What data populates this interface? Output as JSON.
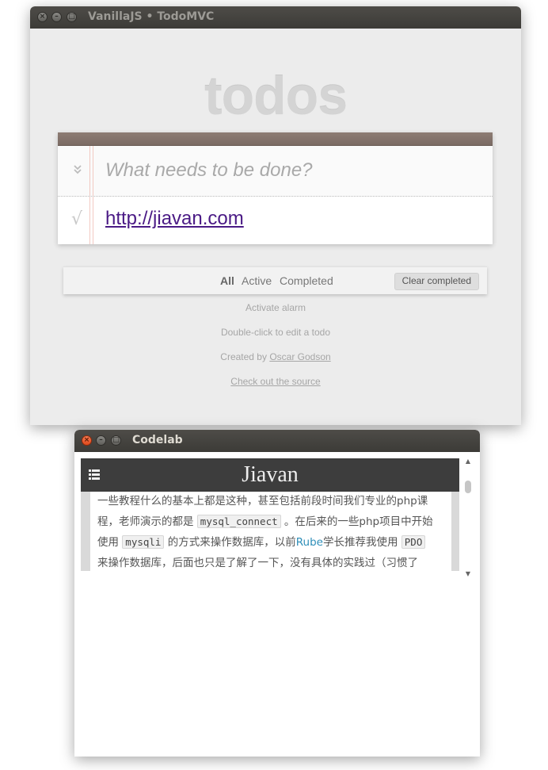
{
  "window1": {
    "title": "VanillaJS • TodoMVC",
    "app_title": "todos",
    "new_todo_placeholder": "What needs to be done?",
    "toggle_all_icon": "double-chevron-down-icon",
    "todos": [
      {
        "text": "http://jiavan.com",
        "completed": true
      }
    ],
    "check_glyph": "√",
    "filters": {
      "all": "All",
      "active": "Active",
      "completed": "Completed",
      "selected": "All"
    },
    "clear_completed": "Clear completed",
    "info": {
      "activate_alarm": "Activate alarm",
      "edit_hint": "Double-click to edit a todo",
      "created_by_prefix": "Created by ",
      "created_by_name": "Oscar Godson",
      "source_link": "Check out the source"
    }
  },
  "window2": {
    "title": "Codelab",
    "site_title": "Jiavan",
    "article": {
      "line1": "一些教程什么的基本上都是这种，甚至包括前段时间我们专业的php课",
      "line2_a": "程，老师演示的都是 ",
      "line2_code": "mysql_connect",
      "line2_b": " 。在后来的一些php项目中开始",
      "line3_a": "使用 ",
      "line3_code": "mysqli",
      "line3_b": " 的方式来操作数据库，以前",
      "line3_link": "Rube",
      "line3_c": "学长推荐我使用 ",
      "line3_code2": "PDO",
      "line4": "来操作数据库，后面也只是了解了一下，没有具体的实践过（习惯了"
    }
  },
  "colors": {
    "title_bar": "#3c3b37",
    "close_button_active": "#df4a1c",
    "todo_header": "#8d7c74",
    "completed_link": "#4a1a85",
    "article_link": "#2f8fb9"
  }
}
